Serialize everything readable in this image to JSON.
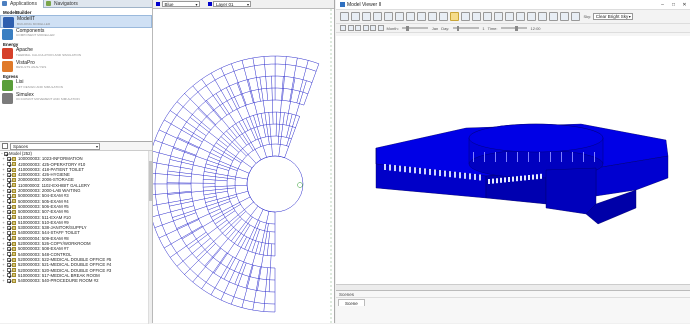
{
  "tabs": [
    {
      "label": "Applications",
      "active": true
    },
    {
      "label": "Navigators",
      "active": false
    }
  ],
  "categories": [
    {
      "name": "ModelBuilder",
      "apps": [
        {
          "name": "ModelIT",
          "desc": "BUILDING MODELLER",
          "color": "#2f5fae",
          "selected": true
        },
        {
          "name": "Components",
          "desc": "COMPONENT MODELLER",
          "color": "#3a7fc2",
          "selected": false
        }
      ]
    },
    {
      "name": "Energy",
      "apps": [
        {
          "name": "Apache",
          "desc": "THERMAL CALCULATION AND SIMULATION",
          "color": "#d6402a",
          "selected": false
        },
        {
          "name": "VistaPro",
          "desc": "RESULTS ANALYSIS",
          "color": "#e07a2a",
          "selected": false
        }
      ]
    },
    {
      "name": "Egress",
      "apps": [
        {
          "name": "Lisi",
          "desc": "LIFT DESIGN AND SIMULATION",
          "color": "#5a9e3a",
          "selected": false
        },
        {
          "name": "Simulex",
          "desc": "OCCUPANT MOVEMENT AND SIMULATION",
          "color": "#7b7b7b",
          "selected": false
        }
      ]
    }
  ],
  "browser": {
    "select_label": "Spaces",
    "root": "Model (252)",
    "rows": [
      "100000003: 1023-INFORMATION",
      "420000003: 425-OPERATORY #10",
      "410000003: 418-PATIENT TOILET",
      "420000003: 426-HYGIENE",
      "200000003: 2006-STORAGE",
      "110000003: 1102-EXHIBIT GALLERY",
      "200000003: 2000-LAB WAITING",
      "500000003: 504-EXAM #3",
      "500000003: 505-EXAM #4",
      "500000003: 506-EXAM #5",
      "500000003: 507-EXAM #6",
      "510000003: 511-EXAM #10",
      "510000003: 510-EXAM #9",
      "530000003: 538-JANITOR/SUPPLY",
      "540000003: 544-STAFF TOILET",
      "500000004: 509-EXAM #8",
      "520000003: 526-COPY/WORKROOM",
      "500000003: 508-EXAM #7",
      "540000003: 548-CONTROL",
      "520000003: 522-MEDICAL DOUBLE OFFICE #5",
      "520000003: 521-MEDICAL DOUBLE OFFICE #4",
      "520000003: 520-MEDICAL DOUBLE OFFICE #3",
      "510000003: 517-MEDICAL BREAK ROOM",
      "540000003: 540-PROCEDURE ROOM #2"
    ]
  },
  "plan": {
    "color_label": "Blue",
    "layer_label": "Layer 01",
    "line_color": "#2a2acc"
  },
  "viewer": {
    "title": "Model Viewer II",
    "month_label": "Month:",
    "month_value": "Jan",
    "day_label": "Day:",
    "day_value": "1",
    "time_label": "Time:",
    "time_value": "12:00",
    "sky_label": "Sky:",
    "sky_value": "Clear Bright Sky",
    "building_color": "#0000e6"
  },
  "scenes": {
    "header": "Scenes",
    "tab_label": "Scene"
  }
}
